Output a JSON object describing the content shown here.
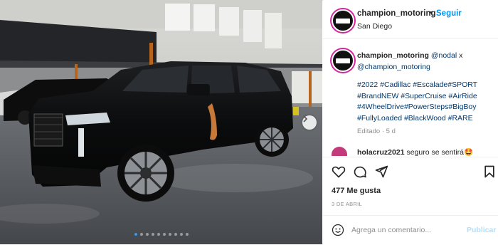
{
  "post": {
    "username": "champion_motoring",
    "follow_label": "Seguir",
    "separator": "•",
    "location": "San Diego",
    "more_icon": "more-dots-icon"
  },
  "caption": {
    "username": "champion_motoring",
    "mention": "@nodal",
    "connector": " x",
    "mention2": "@champion_motoring",
    "hashtags": "#2022 #Cadillac #Escalade#SPORT #BrandNEW #SuperCruise #AirRide #4WheelDrive#PowerSteps#BigBoy #FullyLoaded #BlackWood #RARE",
    "edited": "Editado · 5 d"
  },
  "comment": {
    "username": "holacruz2021",
    "text": "seguro se sentirá🤩"
  },
  "actions": {
    "like_icon": "heart-icon",
    "comment_icon": "comment-icon",
    "share_icon": "share-icon",
    "save_icon": "bookmark-icon"
  },
  "likes": "477 Me gusta",
  "date": "3 DE ABRIL",
  "comment_box": {
    "placeholder": "Agrega un comentario...",
    "publish_label": "Publicar"
  },
  "carousel": {
    "dot_count": 10,
    "active_index": 0
  },
  "colors": {
    "link": "#00376b",
    "follow": "#0095f6",
    "publish": "#b2dffc",
    "active_dot": "#3897f0"
  }
}
